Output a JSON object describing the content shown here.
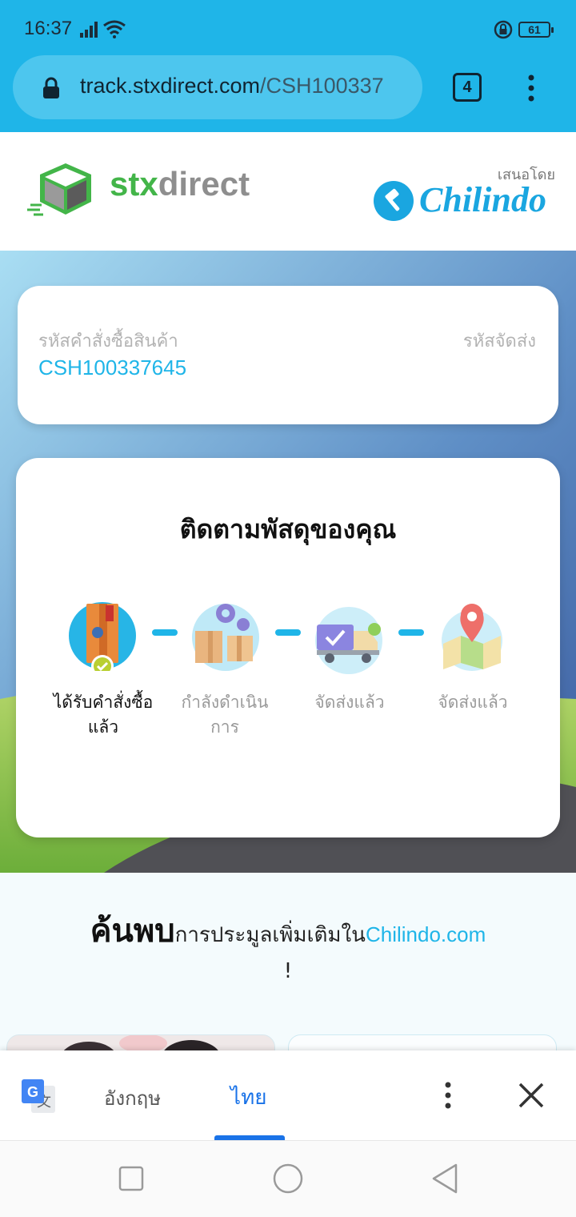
{
  "status_bar": {
    "time": "16:37",
    "battery": "61",
    "icons": [
      "signal-icon",
      "wifi-icon",
      "rotation-lock-icon",
      "battery-icon"
    ]
  },
  "browser": {
    "url_host": "track.stxdirect.com",
    "url_path": "/CSH100337",
    "tab_count": "4"
  },
  "header": {
    "stx_logo_part1": "stx",
    "stx_logo_part2": "direct",
    "presented_by": "เสนอโดย",
    "partner_name": "Chilindo"
  },
  "order": {
    "order_label": "รหัสคำสั่งซื้อสินค้า",
    "shipping_label": "รหัสจัดส่ง",
    "order_number": "CSH100337645"
  },
  "tracking": {
    "title": "ติดตามพัสดุของคุณ",
    "steps": [
      {
        "label": "ได้รับคำสั่งซื้อแล้ว",
        "active": true,
        "icon": "order-box-icon"
      },
      {
        "label": "กำลังดำเนินการ",
        "active": false,
        "icon": "processing-boxes-icon"
      },
      {
        "label": "จัดส่งแล้ว",
        "active": false,
        "icon": "delivery-truck-icon"
      },
      {
        "label": "จัดส่งแล้ว",
        "active": false,
        "icon": "map-pin-icon"
      }
    ]
  },
  "discover": {
    "big": "ค้นพบ",
    "rest": "การประมูลเพิ่มเติมใน",
    "link": "Chilindo.com",
    "exclaim": "!"
  },
  "translate_bar": {
    "lang_source": "อังกฤษ",
    "lang_target": "ไทย"
  },
  "colors": {
    "chrome_blue": "#1fb5e8",
    "brand_green": "#43b549",
    "translate_blue": "#1a73e8"
  }
}
